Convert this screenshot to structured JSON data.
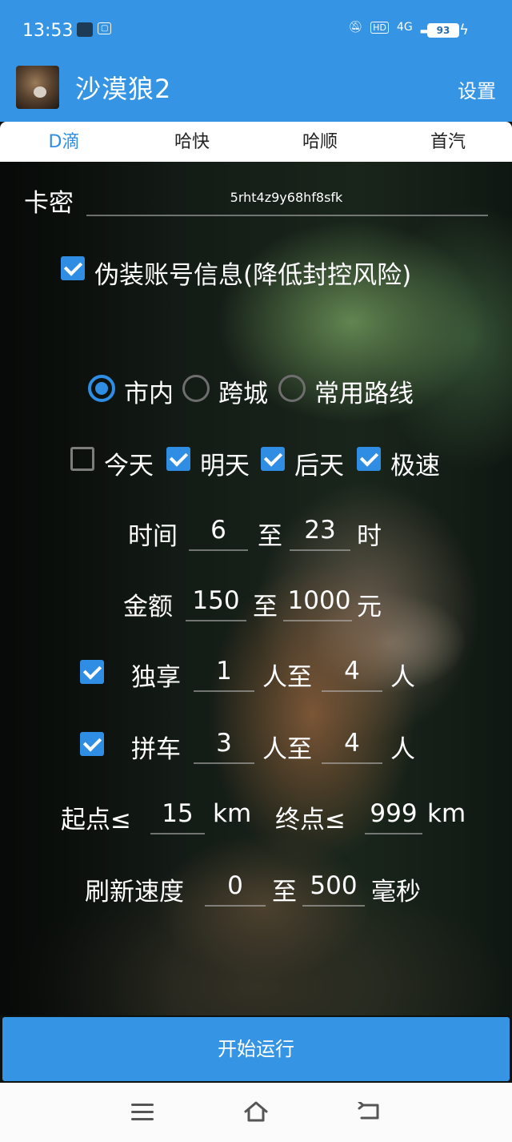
{
  "status_bar": {
    "time": "13:53",
    "network": "4G",
    "battery": "93"
  },
  "app": {
    "title": "沙漠狼2",
    "settings_label": "设置"
  },
  "tabs": [
    {
      "label": "D滴",
      "active": true
    },
    {
      "label": "哈快",
      "active": false
    },
    {
      "label": "哈顺",
      "active": false
    },
    {
      "label": "首汽",
      "active": false
    }
  ],
  "form": {
    "key_label": "卡密",
    "key_value": "5rht4z9y68hf8sfk",
    "disguise": {
      "label": "伪装账号信息(降低封控风险)",
      "checked": true
    },
    "route_options": [
      {
        "label": "市内",
        "selected": true
      },
      {
        "label": "跨城",
        "selected": false
      },
      {
        "label": "常用路线",
        "selected": false
      }
    ],
    "days": [
      {
        "label": "今天",
        "checked": false
      },
      {
        "label": "明天",
        "checked": true
      },
      {
        "label": "后天",
        "checked": true
      },
      {
        "label": "极速",
        "checked": true
      }
    ],
    "time": {
      "label": "时间",
      "from": "6",
      "to_label": "至",
      "to": "23",
      "unit": "时"
    },
    "amount": {
      "label": "金额",
      "from": "150",
      "to_label": "至",
      "to": "1000",
      "unit": "元"
    },
    "exclusive": {
      "checked": true,
      "label": "独享",
      "from": "1",
      "mid": "人至",
      "to": "4",
      "unit": "人"
    },
    "carpool": {
      "checked": true,
      "label": "拼车",
      "from": "3",
      "mid": "人至",
      "to": "4",
      "unit": "人"
    },
    "distance": {
      "start_label": "起点≤",
      "start": "15",
      "start_unit": "km",
      "end_label": "终点≤",
      "end": "999",
      "end_unit": "km"
    },
    "refresh": {
      "label": "刷新速度",
      "from": "0",
      "to_label": "至",
      "to": "500",
      "unit": "毫秒"
    }
  },
  "run_button": "开始运行",
  "colors": {
    "primary": "#3594e4",
    "accent": "#2f8de3"
  }
}
